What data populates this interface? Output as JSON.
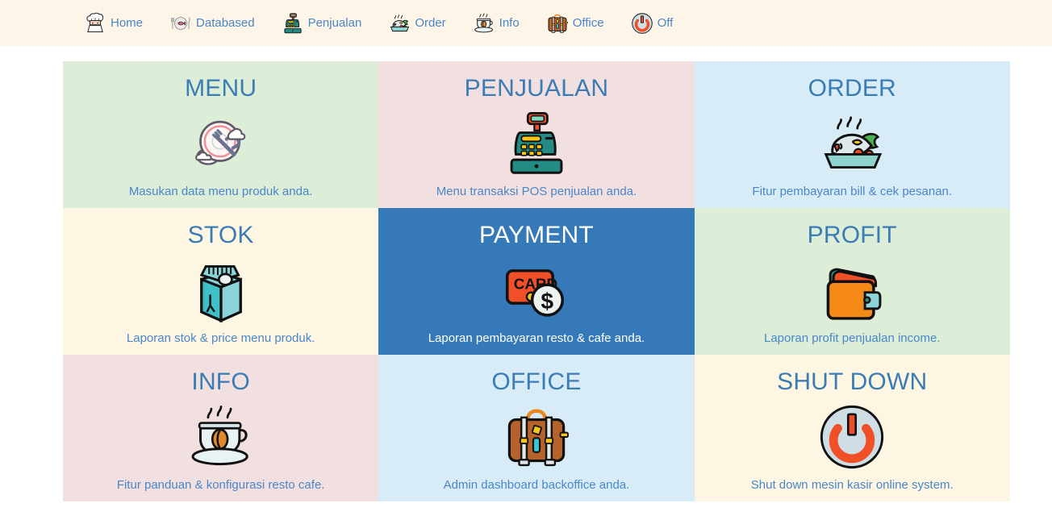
{
  "theme": {
    "header_bg": "#fdf5e7",
    "link_blue": "#4a86c8",
    "title_blue": "#3b7cb5",
    "active_bg": "#3579b8",
    "active_text": "#ffffff",
    "page_bg": "#ffffff"
  },
  "nav": {
    "items": [
      {
        "label": "Home",
        "icon": "chef-hat-icon"
      },
      {
        "label": "Databased",
        "icon": "plate-fish-cutlery-icon"
      },
      {
        "label": "Penjualan",
        "icon": "cash-register-icon"
      },
      {
        "label": "Order",
        "icon": "fish-dish-icon"
      },
      {
        "label": "Info",
        "icon": "coffee-cup-icon"
      },
      {
        "label": "Office",
        "icon": "suitcase-icon"
      },
      {
        "label": "Off",
        "icon": "power-button-icon"
      }
    ]
  },
  "grid": {
    "tiles": [
      {
        "title": "MENU",
        "caption": "Masukan data menu produk anda.",
        "icon": "plate-fork-icon",
        "bg": "#dcedd8",
        "active": false
      },
      {
        "title": "PENJUALAN",
        "caption": "Menu transaksi POS penjualan anda.",
        "icon": "cash-register-icon",
        "bg": "#f2dfe0",
        "active": false
      },
      {
        "title": "ORDER",
        "caption": "Fitur pembayaran bill & cek pesanan.",
        "icon": "fish-dish-icon",
        "bg": "#d8ecf7",
        "active": false
      },
      {
        "title": "STOK",
        "caption": "Laporan stok & price menu produk.",
        "icon": "milk-carton-icon",
        "bg": "#fdf6e3",
        "active": false
      },
      {
        "title": "PAYMENT",
        "caption": "Laporan pembayaran resto & cafe anda.",
        "icon": "card-coin-icon",
        "bg": "#3579b8",
        "active": true
      },
      {
        "title": "PROFIT",
        "caption": "Laporan profit penjualan income.",
        "icon": "wallet-icon",
        "bg": "#dcedd8",
        "active": false
      },
      {
        "title": "INFO",
        "caption": "Fitur panduan & konfigurasi resto cafe.",
        "icon": "coffee-cup-icon",
        "bg": "#f2dfe0",
        "active": false
      },
      {
        "title": "OFFICE",
        "caption": "Admin dashboard backoffice anda.",
        "icon": "suitcase-icon",
        "bg": "#d8ecf7",
        "active": false
      },
      {
        "title": "SHUT DOWN",
        "caption": "Shut down mesin kasir online system.",
        "icon": "power-button-icon",
        "bg": "#fdf6e3",
        "active": false
      }
    ]
  }
}
